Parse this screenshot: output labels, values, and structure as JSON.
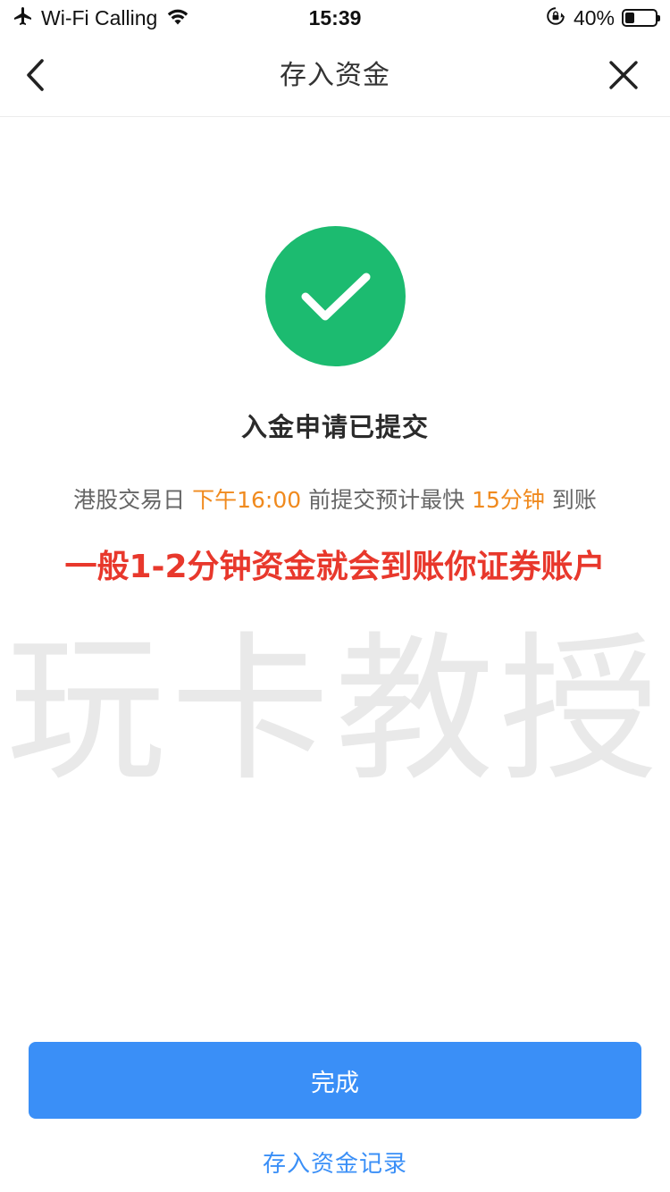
{
  "status_bar": {
    "carrier": "Wi-Fi Calling",
    "time": "15:39",
    "battery_text": "40%",
    "battery_level": 0.4,
    "icons": [
      "airplane-icon",
      "wifi-icon",
      "orientation-lock-icon",
      "battery-icon"
    ]
  },
  "nav": {
    "title": "存入资金",
    "back_icon": "chevron-left-icon",
    "close_icon": "close-icon"
  },
  "result": {
    "icon": "check-icon",
    "title": "入金申请已提交",
    "desc_part1": "港股交易日 ",
    "desc_time": "下午16:00",
    "desc_part2": " 前提交预计最快 ",
    "desc_duration": "15分钟",
    "desc_part3": " 到账"
  },
  "annotation": {
    "text": "一般1-2分钟资金就会到账你证券账户"
  },
  "watermark": {
    "text": "玩卡教授"
  },
  "actions": {
    "done_label": "完成",
    "record_label": "存入资金记录"
  },
  "colors": {
    "success_green": "#1cbb70",
    "primary_blue": "#3a8ff7",
    "link_blue": "#3a8ff7",
    "highlight_orange": "#f08a1e",
    "annotation_red": "#e8382c"
  }
}
